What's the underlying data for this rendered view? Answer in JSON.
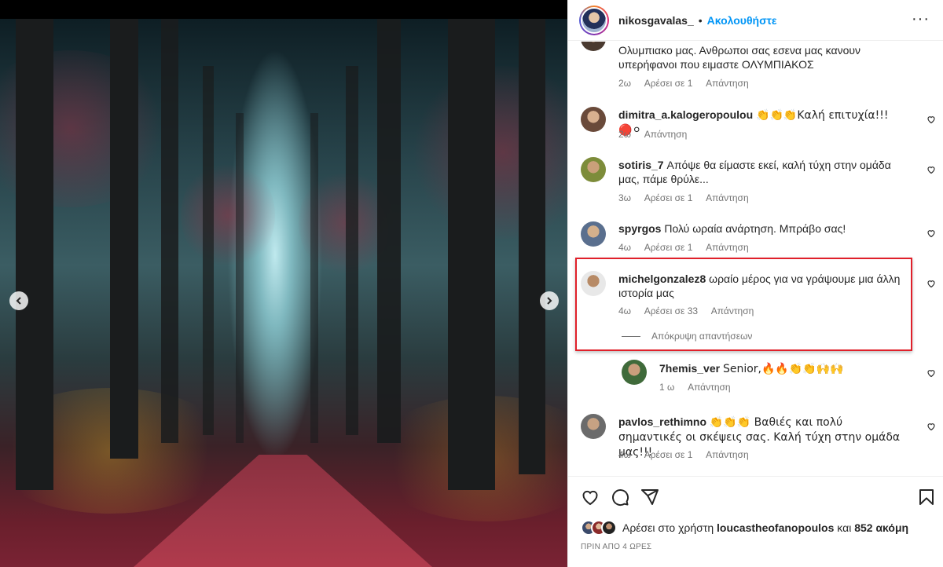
{
  "post": {
    "author": "nikosgavalas_",
    "separator": "•",
    "follow_label": "Ακολουθήστε",
    "more_icon": "more-horizontal-icon"
  },
  "comments": [
    {
      "username": "",
      "text": "Ολυμπιακο μας. Ανθρωποι σας εσενα μας κανουν υπερήφανοι που ειμαστε ΟΛΥΜΠΙΑΚΟΣ",
      "time": "2ω",
      "likes": "Αρέσει σε 1",
      "reply": "Απάντηση"
    },
    {
      "username": "dimitra_a.kalogeropoulou",
      "text": "👏👏👏Καλή επιτυχία!!!🔴⚪",
      "time": "2ω",
      "likes": "",
      "reply": "Απάντηση"
    },
    {
      "username": "sotiris_7",
      "text": "Απόψε θα είμαστε εκεί, καλή τύχη στην ομάδα μας, πάμε θρύλε...",
      "time": "3ω",
      "likes": "Αρέσει σε 1",
      "reply": "Απάντηση"
    },
    {
      "username": "spyrgos",
      "text": "Πολύ ωραία ανάρτηση. Μπράβο σας!",
      "time": "4ω",
      "likes": "Αρέσει σε 1",
      "reply": "Απάντηση"
    },
    {
      "username": "michelgonzalez8",
      "text": "ωραίο μέρος για να γράψουμε μια άλλη ιστορία μας",
      "time": "4ω",
      "likes": "Αρέσει σε 33",
      "reply": "Απάντηση",
      "hide_replies": "Απόκρυψη απαντήσεων"
    },
    {
      "username": "7hemis_ver",
      "text": "Senior,🔥🔥👏👏🙌🙌",
      "time": "1 ω",
      "likes": "",
      "reply": "Απάντηση"
    },
    {
      "username": "pavlos_rethimno",
      "text": "👏👏👏 Βαθιές και πολύ σημαντικές οι σκέψεις σας. Καλή τύχη στην ομάδα μας!!!",
      "time": "4ω",
      "likes": "Αρέσει σε 1",
      "reply": "Απάντηση"
    }
  ],
  "footer": {
    "likes_prefix": "Αρέσει στο χρήστη",
    "likes_user": "loucastheofanopoulos",
    "likes_mid": "και",
    "likes_count": "852 ακόμη",
    "posted_ago": "ΠΡΙΝ ΑΠΟ 4 ΩΡΕΣ"
  },
  "icons": {
    "like": "heart-icon",
    "comment": "comment-icon",
    "share": "share-icon",
    "save": "bookmark-icon",
    "prev": "chevron-left-icon",
    "next": "chevron-right-icon"
  },
  "colors": {
    "accent": "#0095f6",
    "highlight_box": "#e0202a",
    "meta_text": "#737373"
  }
}
